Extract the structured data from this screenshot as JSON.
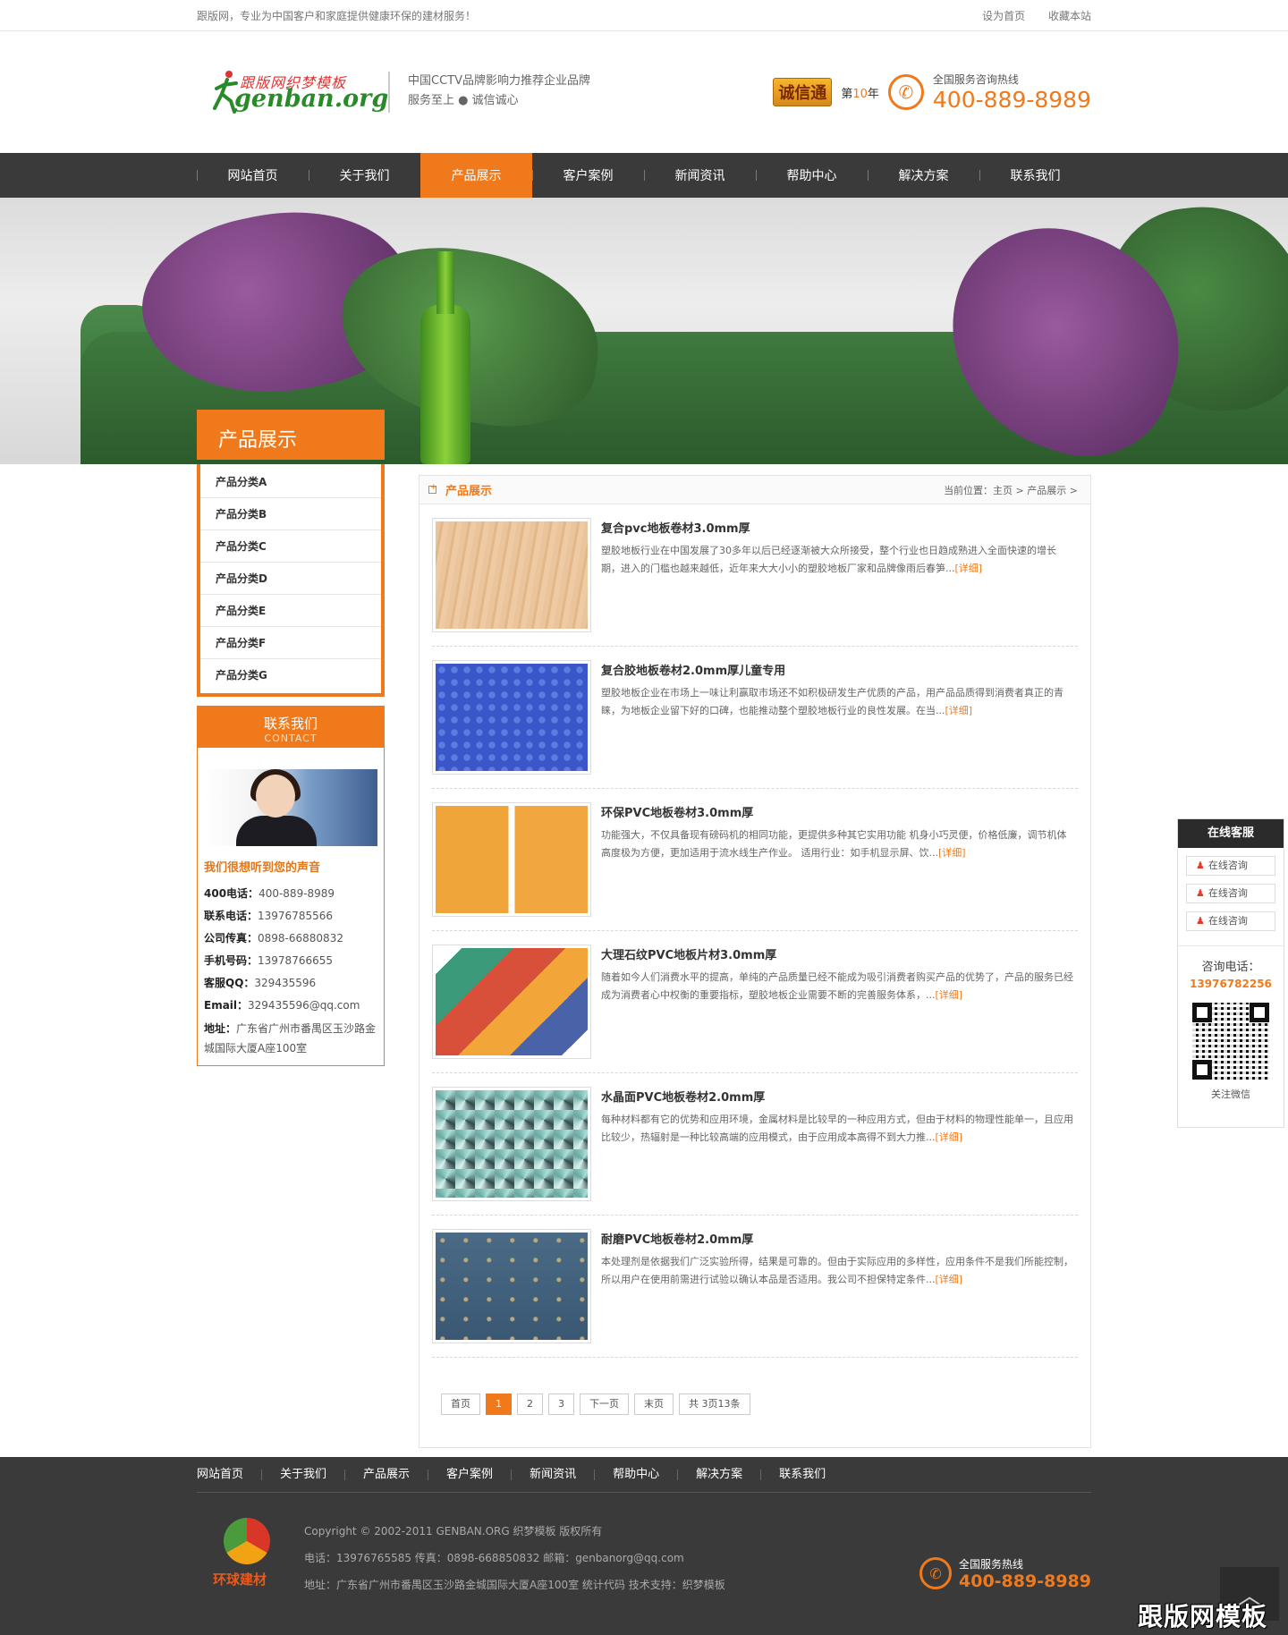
{
  "topbar": {
    "welcome": "跟版网，专业为中国客户和家庭提供健康环保的建材服务！",
    "set_home": "设为首页",
    "bookmark": "收藏本站"
  },
  "header": {
    "logo_cn": "跟版网织梦模板",
    "logo_en": "genban.org",
    "slogan1": "中国CCTV品牌影响力推荐企业品牌",
    "slogan2": "服务至上 ● 诚信诚心",
    "badge": "诚信通",
    "year_pre": "第",
    "year_num": "10",
    "year_suf": "年",
    "hotline_label": "全国服务咨询热线",
    "hotline": "400-889-8989"
  },
  "nav": [
    "网站首页",
    "关于我们",
    "产品展示",
    "客户案例",
    "新闻资讯",
    "帮助中心",
    "解决方案",
    "联系我们"
  ],
  "sidebar": {
    "title": "产品展示",
    "categories": [
      "产品分类A",
      "产品分类B",
      "产品分类C",
      "产品分类D",
      "产品分类E",
      "产品分类F",
      "产品分类G"
    ]
  },
  "contact": {
    "title": "联系我们",
    "subtitle": "CONTACT",
    "quote": "我们很想听到您的声音",
    "rows": [
      [
        "400电话：",
        "400-889-8989"
      ],
      [
        "联系电话：",
        "13976785566"
      ],
      [
        "公司传真：",
        "0898-66880832"
      ],
      [
        "手机号码：",
        "13978766655"
      ],
      [
        "客服QQ：",
        "329435596"
      ],
      [
        "Email：",
        "329435596@qq.com"
      ],
      [
        "地址：",
        "广东省广州市番禺区玉沙路金城国际大厦A座100室"
      ]
    ]
  },
  "content": {
    "title": "产品展示",
    "breadcrumb": "当前位置：主页 > 产品展示 >",
    "more": "[详细]",
    "products": [
      {
        "title": "复合pvc地板卷材3.0mm厚",
        "desc": "塑胶地板行业在中国发展了30多年以后已经逐渐被大众所接受，整个行业也日趋成熟进入全面快速的增长期，进入的门槛也越来越低，近年来大大小小的塑胶地板厂家和品牌像雨后春笋...",
        "swatch": "wood"
      },
      {
        "title": "复合胶地板卷材2.0mm厚儿童专用",
        "desc": "塑胶地板企业在市场上一味让利赢取市场还不如积极研发生产优质的产品，用产品品质得到消费者真正的青睐，为地板企业留下好的口碑，也能推动整个塑胶地板行业的良性发展。在当...",
        "swatch": "blue"
      },
      {
        "title": "环保PVC地板卷材3.0mm厚",
        "desc": "功能强大，不仅具备现有磅码机的相同功能，更提供多种其它实用功能 机身小巧灵便，价格低廉，调节机体高度极为方便，更加适用于流水线生产作业。 适用行业：如手机显示屏、饮...",
        "swatch": "yellow"
      },
      {
        "title": "大理石纹PVC地板片材3.0mm厚",
        "desc": "随着如今人们消费水平的提高，单纯的产品质量已经不能成为吸引消费者购买产品的优势了，产品的服务已经成为消费者心中权衡的重要指标，塑胶地板企业需要不断的完善服务体系，...",
        "swatch": "multi"
      },
      {
        "title": "水晶面PVC地板卷材2.0mm厚",
        "desc": "每种材料都有它的优势和应用环境，金属材料是比较早的一种应用方式，但由于材料的物理性能单一，且应用比较少，热辐射是一种比较高端的应用模式，由于应用成本高得不到大力推...",
        "swatch": "mosaic"
      },
      {
        "title": "耐磨PVC地板卷材2.0mm厚",
        "desc": "本处理剂是依据我们广泛实验所得，结果是可靠的。但由于实际应用的多样性，应用条件不是我们所能控制，所以用户在使用前需进行试验以确认本品是否适用。我公司不担保特定条件...",
        "swatch": "slate"
      }
    ],
    "pager": {
      "first": "首页",
      "pages": [
        "1",
        "2",
        "3"
      ],
      "next": "下一页",
      "last": "末页",
      "total": "共 3页13条"
    }
  },
  "service": {
    "title": "在线客服",
    "btn": "在线咨询",
    "tel_label": "咨询电话：",
    "tel": "13976782256",
    "qr_label": "关注微信"
  },
  "footer": {
    "nav": [
      "网站首页",
      "关于我们",
      "产品展示",
      "客户案例",
      "新闻资讯",
      "帮助中心",
      "解决方案",
      "联系我们"
    ],
    "brand": "环球建材",
    "copyright": "Copyright © 2002-2011 GENBAN.ORG 织梦模板 版权所有",
    "contact": "电话：13976765585 传真：0898-668850832 邮箱：genbanorg@qq.com",
    "address": "地址：广东省广州市番禺区玉沙路金城国际大厦A座100室 统计代码 技术支持：织梦模板",
    "hot_label": "全国服务热线",
    "hot": "400-889-8989"
  },
  "watermark": "跟版网模板",
  "colors": {
    "accent": "#f07a1b",
    "nav_bg": "#3a3a3a"
  }
}
